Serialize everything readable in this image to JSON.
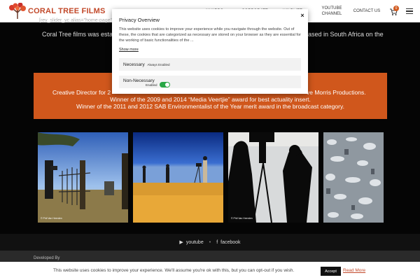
{
  "header": {
    "logo_text": "CORAL TREE FILMS",
    "nav": [
      {
        "label": "AWARDS"
      },
      {
        "label": "CORPORATE"
      },
      {
        "label": "WILDLIFE"
      },
      {
        "label": "YOUTUBE CHANNEL"
      },
      {
        "label": "CONTACT US"
      }
    ],
    "cart_count": "0"
  },
  "intro": {
    "shortcode": "[rev_slider_vc alias=\"home-page\"]",
    "text_left": "Coral Tree films was estab",
    "text_right": "ased in South Africa on the"
  },
  "banner": {
    "line1_left": "Creative Director for 2",
    "line1_right": "ve Morris Productions.",
    "line2": "Winner of the 2009 and 2014 “Media Veertjie” award for best actuality insert.",
    "line3": "Winner of the 2011 and 2012 SAB Environmentalist of the Year merit award in the broadcast category."
  },
  "gallery": {
    "credits": [
      "© Phil Van Heerden",
      "© Phil Van Heerden"
    ]
  },
  "social": {
    "youtube": "youtube",
    "facebook": "facebook"
  },
  "footer": {
    "developed_by": "Developed By"
  },
  "cookie_bar": {
    "text": "This website uses cookies to improve your experience. We'll assume you're ok with this, but you can opt-out if you wish.",
    "accept": "Accept",
    "read_more": "Read More"
  },
  "privacy_modal": {
    "title": "Privacy Overview",
    "close": "×",
    "body": "This website uses cookies to improve your experience while you navigate through the website. Out of these, the cookies that are categorized as necessary are stored on your browser as they are essential for the working of basic functionalities of the ...",
    "show_more": "Show more",
    "necessary_label": "Necessary",
    "necessary_status": "Always Enabled",
    "non_necessary_label": "Non-Necessary",
    "non_necessary_toggle": "Enabled"
  },
  "colors": {
    "brand": "#c2492a",
    "banner": "#d0571c",
    "toggle_on": "#28a745"
  }
}
